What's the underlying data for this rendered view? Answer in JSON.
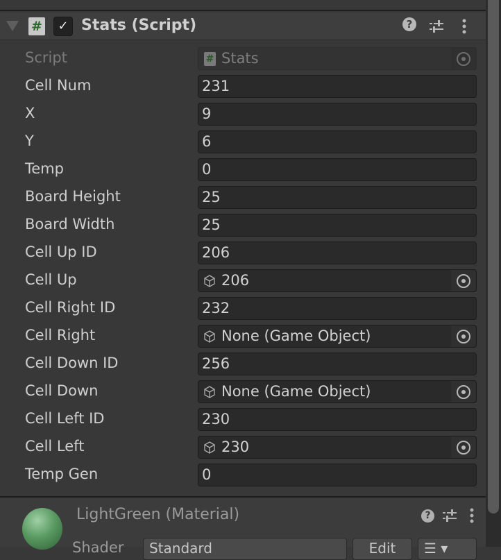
{
  "component": {
    "title": "Stats (Script)",
    "enabled": true
  },
  "script_row": {
    "label": "Script",
    "value": "Stats"
  },
  "fields": [
    {
      "label": "Cell Num",
      "value": "231",
      "type": "int"
    },
    {
      "label": "X",
      "value": "9",
      "type": "int"
    },
    {
      "label": "Y",
      "value": "6",
      "type": "int"
    },
    {
      "label": "Temp",
      "value": "0",
      "type": "int"
    },
    {
      "label": "Board Height",
      "value": "25",
      "type": "int"
    },
    {
      "label": "Board Width",
      "value": "25",
      "type": "int"
    },
    {
      "label": "Cell Up ID",
      "value": "206",
      "type": "int"
    },
    {
      "label": "Cell Up",
      "value": "206",
      "type": "object"
    },
    {
      "label": "Cell Right ID",
      "value": "232",
      "type": "int"
    },
    {
      "label": "Cell Right",
      "value": "None (Game Object)",
      "type": "object"
    },
    {
      "label": "Cell Down ID",
      "value": "256",
      "type": "int"
    },
    {
      "label": "Cell Down",
      "value": "None (Game Object)",
      "type": "object"
    },
    {
      "label": "Cell Left ID",
      "value": "230",
      "type": "int"
    },
    {
      "label": "Cell Left",
      "value": "230",
      "type": "object"
    },
    {
      "label": "Temp Gen",
      "value": "0",
      "type": "int"
    }
  ],
  "material": {
    "title": "LightGreen (Material)",
    "shader_label": "Shader",
    "shader_value": "Standard",
    "edit_label": "Edit"
  }
}
